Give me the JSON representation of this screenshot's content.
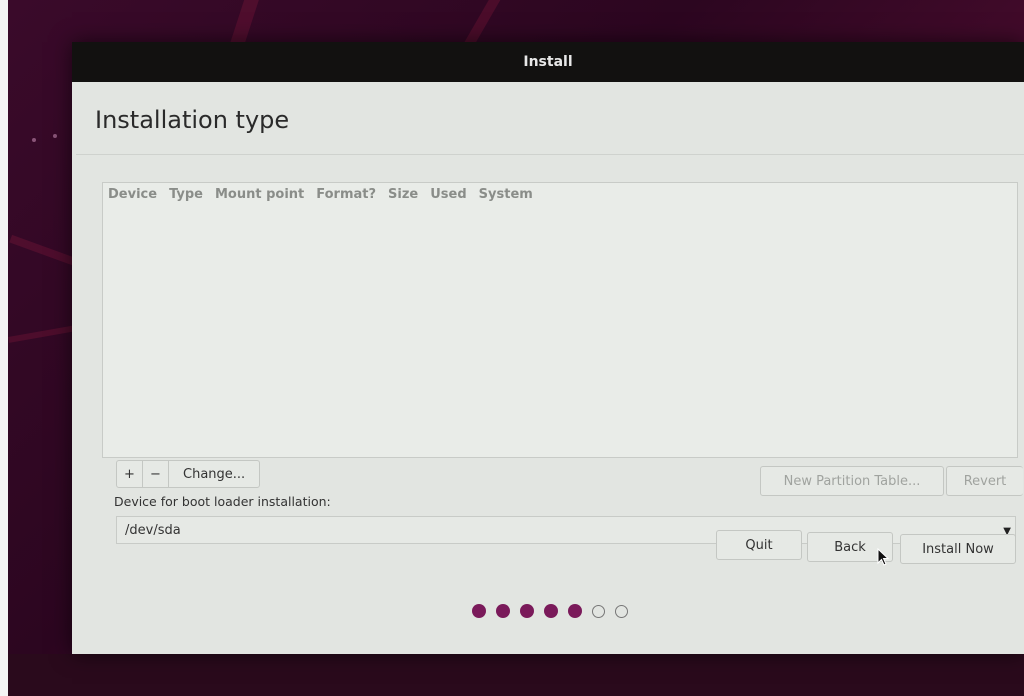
{
  "window": {
    "title": "Install"
  },
  "page": {
    "title": "Installation type"
  },
  "partition_table": {
    "columns": [
      "Device",
      "Type",
      "Mount point",
      "Format?",
      "Size",
      "Used",
      "System"
    ],
    "rows": []
  },
  "partition_toolbar": {
    "add_label": "+",
    "remove_label": "−",
    "change_label": "Change...",
    "new_partition_table_label": "New Partition Table...",
    "revert_label": "Revert"
  },
  "boot_loader": {
    "label": "Device for boot loader installation:",
    "selected": "/dev/sda",
    "dropdown_icon": "triangle-down-icon"
  },
  "actions": {
    "quit_label": "Quit",
    "back_label": "Back",
    "install_now_label": "Install Now"
  },
  "progress": {
    "total_steps": 7,
    "completed_steps": 5,
    "filled_color": "#7a1a5a"
  }
}
